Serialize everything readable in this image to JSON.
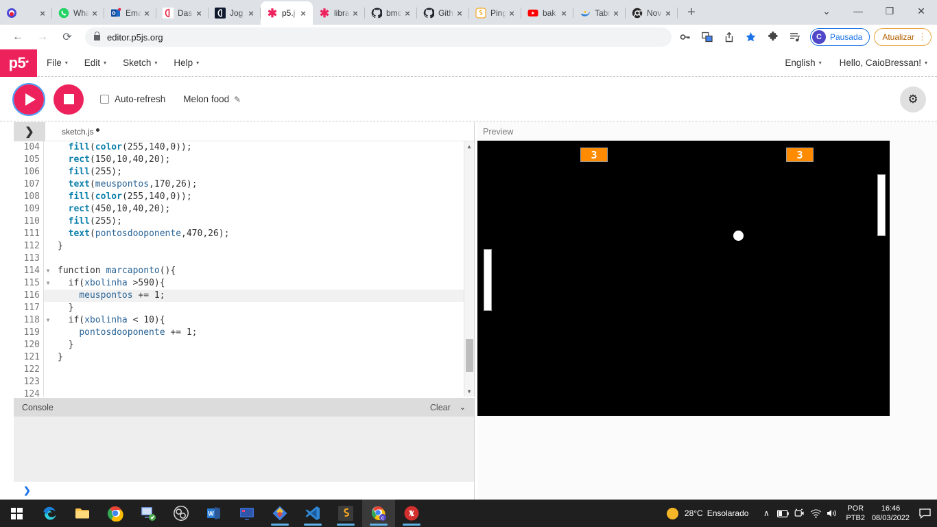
{
  "browser": {
    "tabs": [
      {
        "title": "",
        "favicon": "screen-recorder-icon",
        "active": false
      },
      {
        "title": "Wha",
        "favicon": "whatsapp-icon",
        "active": false
      },
      {
        "title": "Ema",
        "favicon": "outlook-icon",
        "active": false
      },
      {
        "title": "Das",
        "favicon": "alura-icon",
        "active": false
      },
      {
        "title": "Jog",
        "favicon": "alura-dark-icon",
        "active": false
      },
      {
        "title": "p5.j",
        "favicon": "p5-asterisk-icon",
        "active": true
      },
      {
        "title": "libra",
        "favicon": "p5-asterisk-icon",
        "active": false
      },
      {
        "title": "bmc",
        "favicon": "github-icon",
        "active": false
      },
      {
        "title": "Gith",
        "favicon": "github-icon",
        "active": false
      },
      {
        "title": "Ping",
        "favicon": "sublime-icon",
        "active": false
      },
      {
        "title": "bak",
        "favicon": "youtube-icon",
        "active": false
      },
      {
        "title": "Tabr",
        "favicon": "swoosh-icon",
        "active": false
      },
      {
        "title": "Nov",
        "favicon": "chromium-icon",
        "active": false
      }
    ],
    "new_tab_label": "+",
    "tab_close_label": "×",
    "tab_search_label": "⌄",
    "minimize_label": "—",
    "maximize_label": "❐",
    "close_label": "✕",
    "back_label": "←",
    "forward_label": "→",
    "reload_label": "⟳",
    "lock_label": "🔒",
    "url": "editor.p5js.org",
    "toolbar_icons": [
      "password-key-icon",
      "translate-icon",
      "share-icon",
      "bookmark-star-icon",
      "extensions-puzzle-icon",
      "reading-list-icon"
    ],
    "profile": {
      "initial": "C",
      "label": "Pausada"
    },
    "update": {
      "label": "Atualizar",
      "kebab": "⋮"
    },
    "accent_blue": "#1a73e8",
    "accent_orange": "#e8a33d"
  },
  "p5": {
    "logo": "p5",
    "logo_sup": "*",
    "brand_color": "#ED225D",
    "menu": [
      {
        "label": "File"
      },
      {
        "label": "Edit"
      },
      {
        "label": "Sketch"
      },
      {
        "label": "Help"
      }
    ],
    "language": "English",
    "greeting": "Hello, CaioBressan!",
    "caret": "▾",
    "toolbar": {
      "play_label": "play-button",
      "stop_label": "stop-button",
      "auto_refresh_label": "Auto-refresh",
      "sketch_name": "Melon food",
      "pencil_icon": "✎",
      "settings_icon": "⚙"
    },
    "editor": {
      "sidebar_toggle": "❯",
      "file_name": "sketch.js",
      "first_line": 104,
      "highlighted_line": 116,
      "lines": [
        {
          "n": 104,
          "fold": "",
          "tokens": [
            {
              "t": "  ",
              "c": "plain"
            },
            {
              "t": "fill",
              "c": "fn"
            },
            {
              "t": "(",
              "c": "plain"
            },
            {
              "t": "color",
              "c": "fn"
            },
            {
              "t": "(255,140,0));",
              "c": "plain"
            }
          ]
        },
        {
          "n": 105,
          "fold": "",
          "tokens": [
            {
              "t": "  ",
              "c": "plain"
            },
            {
              "t": "rect",
              "c": "fn"
            },
            {
              "t": "(150,10,40,20);",
              "c": "plain"
            }
          ]
        },
        {
          "n": 106,
          "fold": "",
          "tokens": [
            {
              "t": "  ",
              "c": "plain"
            },
            {
              "t": "fill",
              "c": "fn"
            },
            {
              "t": "(255);",
              "c": "plain"
            }
          ]
        },
        {
          "n": 107,
          "fold": "",
          "tokens": [
            {
              "t": "  ",
              "c": "plain"
            },
            {
              "t": "text",
              "c": "fn"
            },
            {
              "t": "(",
              "c": "plain"
            },
            {
              "t": "meuspontos",
              "c": "var"
            },
            {
              "t": ",170,26);",
              "c": "plain"
            }
          ]
        },
        {
          "n": 108,
          "fold": "",
          "tokens": [
            {
              "t": "  ",
              "c": "plain"
            },
            {
              "t": "fill",
              "c": "fn"
            },
            {
              "t": "(",
              "c": "plain"
            },
            {
              "t": "color",
              "c": "fn"
            },
            {
              "t": "(255,140,0));",
              "c": "plain"
            }
          ]
        },
        {
          "n": 109,
          "fold": "",
          "tokens": [
            {
              "t": "  ",
              "c": "plain"
            },
            {
              "t": "rect",
              "c": "fn"
            },
            {
              "t": "(450,10,40,20);",
              "c": "plain"
            }
          ]
        },
        {
          "n": 110,
          "fold": "",
          "tokens": [
            {
              "t": "  ",
              "c": "plain"
            },
            {
              "t": "fill",
              "c": "fn"
            },
            {
              "t": "(255);",
              "c": "plain"
            }
          ]
        },
        {
          "n": 111,
          "fold": "",
          "tokens": [
            {
              "t": "  ",
              "c": "plain"
            },
            {
              "t": "text",
              "c": "fn"
            },
            {
              "t": "(",
              "c": "plain"
            },
            {
              "t": "pontosdooponente",
              "c": "var"
            },
            {
              "t": ",470,26);",
              "c": "plain"
            }
          ]
        },
        {
          "n": 112,
          "fold": "",
          "tokens": [
            {
              "t": "}",
              "c": "plain"
            }
          ]
        },
        {
          "n": 113,
          "fold": "",
          "tokens": [
            {
              "t": "",
              "c": "plain"
            }
          ]
        },
        {
          "n": 114,
          "fold": "▼",
          "tokens": [
            {
              "t": "function ",
              "c": "plain"
            },
            {
              "t": "marcaponto",
              "c": "var"
            },
            {
              "t": "(){",
              "c": "plain"
            }
          ]
        },
        {
          "n": 115,
          "fold": "▼",
          "tokens": [
            {
              "t": "  if(",
              "c": "plain"
            },
            {
              "t": "xbolinha",
              "c": "var"
            },
            {
              "t": " >590){",
              "c": "plain"
            }
          ]
        },
        {
          "n": 116,
          "fold": "",
          "tokens": [
            {
              "t": "    ",
              "c": "plain"
            },
            {
              "t": "meuspontos",
              "c": "var"
            },
            {
              "t": " += 1;",
              "c": "plain"
            }
          ]
        },
        {
          "n": 117,
          "fold": "",
          "tokens": [
            {
              "t": "  }",
              "c": "plain"
            }
          ]
        },
        {
          "n": 118,
          "fold": "▼",
          "tokens": [
            {
              "t": "  if(",
              "c": "plain"
            },
            {
              "t": "xbolinha",
              "c": "var"
            },
            {
              "t": " < 10){",
              "c": "plain"
            }
          ]
        },
        {
          "n": 119,
          "fold": "",
          "tokens": [
            {
              "t": "    ",
              "c": "plain"
            },
            {
              "t": "pontosdooponente",
              "c": "var"
            },
            {
              "t": " += 1;",
              "c": "plain"
            }
          ]
        },
        {
          "n": 120,
          "fold": "",
          "tokens": [
            {
              "t": "  }",
              "c": "plain"
            }
          ]
        },
        {
          "n": 121,
          "fold": "",
          "tokens": [
            {
              "t": "}",
              "c": "plain"
            }
          ]
        },
        {
          "n": 122,
          "fold": "",
          "tokens": [
            {
              "t": "",
              "c": "plain"
            }
          ]
        },
        {
          "n": 123,
          "fold": "",
          "tokens": [
            {
              "t": "",
              "c": "plain"
            }
          ]
        },
        {
          "n": 124,
          "fold": "",
          "tokens": [
            {
              "t": "",
              "c": "plain"
            }
          ]
        }
      ],
      "scroll_up": "▲",
      "scroll_down": "▼"
    },
    "console": {
      "title": "Console",
      "clear_label": "Clear",
      "collapse_icon": "⌄",
      "prompt": "❯",
      "messages": []
    },
    "preview": {
      "label": "Preview",
      "canvas": {
        "background": "#000000",
        "score_left": "3",
        "score_right": "3",
        "score_color": "#FF8C00",
        "paddle_color": "#FFFFFF",
        "ball_color": "#FFFFFF"
      }
    }
  },
  "taskbar": {
    "start_label": "start-button",
    "apps": [
      {
        "name": "edge-icon",
        "active": false,
        "running": false
      },
      {
        "name": "file-explorer-icon",
        "active": false,
        "running": false
      },
      {
        "name": "chrome-icon",
        "active": false,
        "running": false
      },
      {
        "name": "remote-desktop-icon",
        "active": false,
        "running": false
      },
      {
        "name": "obs-studio-icon",
        "active": false,
        "running": false
      },
      {
        "name": "word-icon",
        "active": false,
        "running": false
      },
      {
        "name": "monitor-app-icon",
        "active": false,
        "running": false
      },
      {
        "name": "paint-net-icon",
        "active": false,
        "running": true
      },
      {
        "name": "vscode-icon",
        "active": false,
        "running": true
      },
      {
        "name": "sublime-text-icon",
        "active": false,
        "running": true
      },
      {
        "name": "chrome-profile-icon",
        "active": true,
        "running": true
      },
      {
        "name": "autohotkey-icon",
        "active": false,
        "running": true
      }
    ],
    "tray": {
      "temperature": "28°C",
      "weather": "Ensolarado",
      "chevron": "∧",
      "icons": [
        "battery-icon",
        "camera-icon",
        "wifi-icon",
        "volume-icon"
      ],
      "lang_line1": "POR",
      "lang_line2": "PTB2",
      "time": "16:46",
      "date": "08/03/2022",
      "notification": "notification-icon"
    }
  }
}
